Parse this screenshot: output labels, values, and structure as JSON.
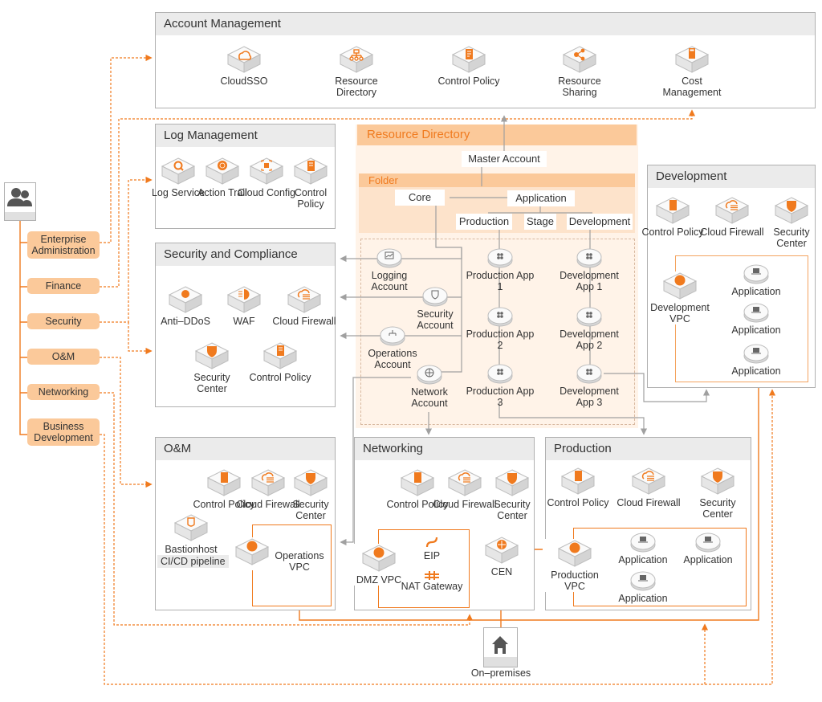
{
  "colors": {
    "accent": "#f07a1e",
    "accent_light": "#fbc99a",
    "panel_head": "#ebebeb",
    "border": "#b0b0b0",
    "connector_gray": "#9a9a9a"
  },
  "users": {
    "icon": "users-icon",
    "roles": [
      "Enterprise Administration",
      "Finance",
      "Security",
      "O&M",
      "Networking",
      "Business Development"
    ]
  },
  "account_management": {
    "title": "Account Management",
    "services": [
      {
        "label": "CloudSSO",
        "icon": "cloud-icon"
      },
      {
        "label": "Resource Directory",
        "icon": "org-tree-icon"
      },
      {
        "label": "Control Policy",
        "icon": "policy-doc-icon"
      },
      {
        "label": "Resource Sharing",
        "icon": "share-icon"
      },
      {
        "label": "Cost Management",
        "icon": "calculator-icon"
      }
    ]
  },
  "log_management": {
    "title": "Log Management",
    "services": [
      {
        "label": "Log Service",
        "icon": "log-search-icon"
      },
      {
        "label": "Action Trail",
        "icon": "radar-icon"
      },
      {
        "label": "Cloud Config",
        "icon": "config-scan-icon"
      },
      {
        "label": "Control Policy",
        "icon": "policy-doc-icon"
      }
    ]
  },
  "security_compliance": {
    "title": "Security and Compliance",
    "services": [
      {
        "label": "Anti–DDoS",
        "icon": "anti-ddos-icon"
      },
      {
        "label": "WAF",
        "icon": "waf-icon"
      },
      {
        "label": "Cloud Firewall",
        "icon": "cloud-firewall-icon"
      },
      {
        "label": "Security Center",
        "icon": "shield-icon"
      },
      {
        "label": "Control Policy",
        "icon": "policy-doc-icon"
      }
    ]
  },
  "resource_directory": {
    "title": "Resource Directory",
    "master": "Master Account",
    "folder_label": "Folder",
    "folders": {
      "core": "Core",
      "application": "Application",
      "children": [
        "Production",
        "Stage",
        "Development"
      ]
    },
    "core_accounts": [
      {
        "label": "Logging Account",
        "icon": "chart-icon"
      },
      {
        "label": "Security Account",
        "icon": "shield-check-icon"
      },
      {
        "label": "Operations Account",
        "icon": "org-tree-icon"
      },
      {
        "label": "Network Account",
        "icon": "globe-icon"
      }
    ],
    "production_apps": [
      "Production App 1",
      "Production App 2",
      "Production App 3"
    ],
    "development_apps": [
      "Development App 1",
      "Development App 2",
      "Development App 3"
    ]
  },
  "development": {
    "title": "Development",
    "services": [
      {
        "label": "Control Policy",
        "icon": "policy-doc-icon"
      },
      {
        "label": "Cloud Firewall",
        "icon": "cloud-firewall-icon"
      },
      {
        "label": "Security Center",
        "icon": "shield-icon"
      }
    ],
    "vpc": "Development VPC",
    "apps": [
      "Application",
      "Application",
      "Application"
    ]
  },
  "om": {
    "title": "O&M",
    "services": [
      {
        "label": "Control Policy",
        "icon": "policy-doc-icon"
      },
      {
        "label": "Cloud Firewall",
        "icon": "cloud-firewall-icon"
      },
      {
        "label": "Security Center",
        "icon": "shield-icon"
      }
    ],
    "bastion": "Bastionhost",
    "pipeline": "CI/CD pipeline",
    "vpc": "Operations VPC"
  },
  "networking": {
    "title": "Networking",
    "services": [
      {
        "label": "Control Policy",
        "icon": "policy-doc-icon"
      },
      {
        "label": "Cloud Firewall",
        "icon": "cloud-firewall-icon"
      },
      {
        "label": "Security Center",
        "icon": "shield-icon"
      }
    ],
    "vpc": "DMZ VPC",
    "eip": "EIP",
    "nat": "NAT Gateway",
    "cen": "CEN"
  },
  "production": {
    "title": "Production",
    "services": [
      {
        "label": "Control Policy",
        "icon": "policy-doc-icon"
      },
      {
        "label": "Cloud Firewall",
        "icon": "cloud-firewall-icon"
      },
      {
        "label": "Security Center",
        "icon": "shield-icon"
      }
    ],
    "vpc": "Production VPC",
    "apps": [
      "Application",
      "Application",
      "Application"
    ]
  },
  "on_premises": {
    "label": "On–premises",
    "icon": "home-icon"
  }
}
